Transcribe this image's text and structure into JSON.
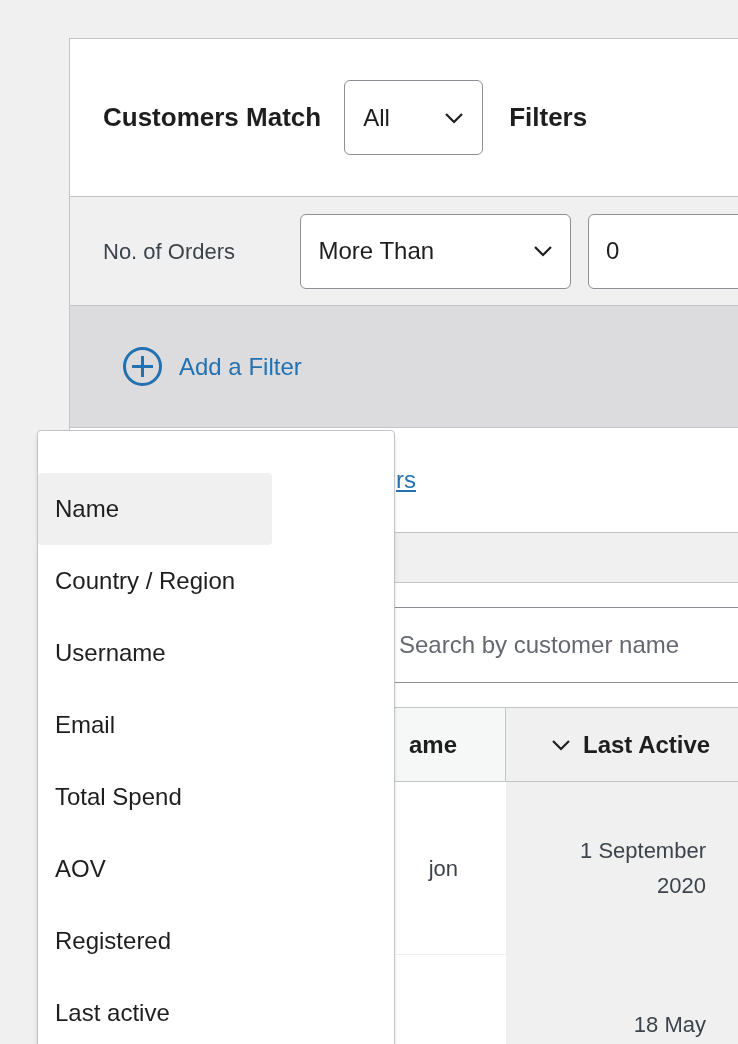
{
  "header": {
    "title": "Customers Match",
    "match_select": "All",
    "suffix": "Filters"
  },
  "filter_row": {
    "label": "No. of Orders",
    "operator": "More Than",
    "value": "0"
  },
  "add_filter": {
    "label": "Add a Filter"
  },
  "link": {
    "text": "rs"
  },
  "search": {
    "placeholder": "Search by customer name"
  },
  "table": {
    "columns": [
      {
        "label": "ame",
        "sorted": false
      },
      {
        "label": "Last Active",
        "sorted": true
      }
    ],
    "rows": [
      [
        "jon",
        "1 September 2020"
      ],
      [
        "",
        "18 May"
      ]
    ]
  },
  "dropdown": {
    "items": [
      {
        "label": "Name",
        "selected": true
      },
      {
        "label": "Country / Region",
        "selected": false
      },
      {
        "label": "Username",
        "selected": false
      },
      {
        "label": "Email",
        "selected": false
      },
      {
        "label": "Total Spend",
        "selected": false
      },
      {
        "label": "AOV",
        "selected": false
      },
      {
        "label": "Registered",
        "selected": false
      },
      {
        "label": "Last active",
        "selected": false
      }
    ]
  }
}
